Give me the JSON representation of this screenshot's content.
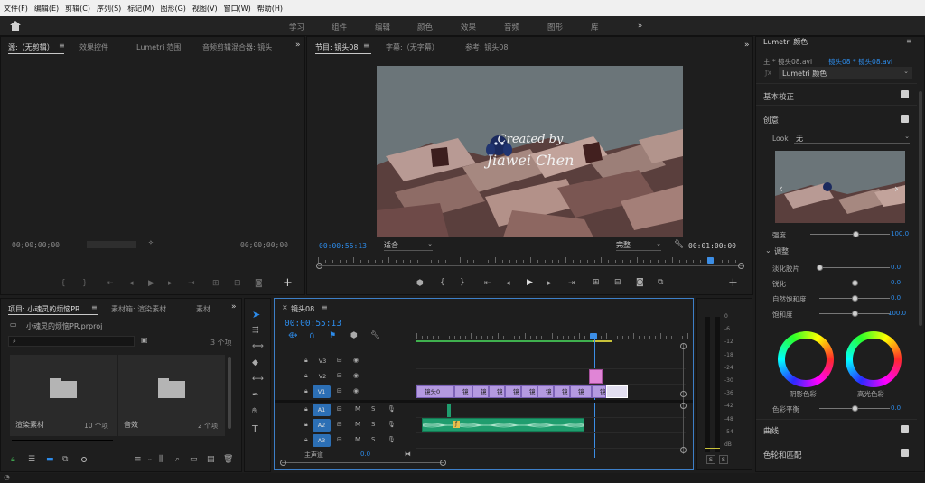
{
  "menu": [
    "文件(F)",
    "编辑(E)",
    "剪辑(C)",
    "序列(S)",
    "标记(M)",
    "图形(G)",
    "视图(V)",
    "窗口(W)",
    "帮助(H)"
  ],
  "workspaces": [
    "学习",
    "组件",
    "编辑",
    "颜色",
    "效果",
    "音频",
    "图形",
    "库"
  ],
  "source_panel": {
    "tabs": [
      "源:（无剪辑）",
      "效果控件",
      "Lumetri 范围",
      "音频剪辑混合器: 镜头"
    ],
    "timecode_left": "00;00;00;00",
    "timecode_right": "00;00;00;00"
  },
  "program_panel": {
    "tabs": [
      "节目: 镜头08",
      "字幕:（无字幕）",
      "参考: 镜头08"
    ],
    "overlay_line1": "Created by",
    "overlay_line2": "Jiawei Chen",
    "timecode": "00:00:55:13",
    "fit": "适合",
    "quality": "完整",
    "duration": "00:01:00:00"
  },
  "project_panel": {
    "tabs": [
      "项目: 小魂灵的烦恼PR",
      "素材箱: 渲染素材",
      "素材"
    ],
    "file": "小魂灵的烦恼PR.prproj",
    "count": "3 个项",
    "bins": [
      {
        "name": "渲染素材",
        "count": "10 个项"
      },
      {
        "name": "音效",
        "count": "2 个项"
      }
    ]
  },
  "timeline": {
    "tab": "镜头08",
    "timecode": "00:00:55:13",
    "video_tracks": [
      "V3",
      "V2",
      "V1"
    ],
    "audio_tracks": [
      "A1",
      "A2",
      "A3"
    ],
    "master": "主声道",
    "master_value": "0.0",
    "m_label": "M",
    "s_label": "S",
    "clip_labels": [
      "镜头0",
      "镜",
      "镜",
      "镜",
      "镜",
      "镜",
      "镜",
      "镜",
      "镜",
      "镜头"
    ]
  },
  "meter": {
    "scale": [
      "0",
      "-6",
      "-12",
      "-18",
      "-24",
      "-30",
      "-36",
      "-42",
      "-48",
      "-54",
      "dB"
    ],
    "solo": [
      "S",
      "S"
    ]
  },
  "lumetri": {
    "title": "Lumetri 颜色",
    "source": "主 * 镜头08.avi",
    "sequence": "镜头08 * 镜头08.avi",
    "fx": "Lumetri 颜色",
    "basic": "基本校正",
    "creative": "创意",
    "look_label": "Look",
    "look_value": "无",
    "intensity_label": "强度",
    "intensity_value": "100.0",
    "adjust": "调整",
    "rows": [
      {
        "label": "淡化胶片",
        "value": "0.0"
      },
      {
        "label": "锐化",
        "value": "0.0"
      },
      {
        "label": "自然饱和度",
        "value": "0.0"
      },
      {
        "label": "饱和度",
        "value": "100.0"
      }
    ],
    "shadow_tint": "阴影色彩",
    "highlight_tint": "高光色彩",
    "tint_balance": "色彩平衡",
    "tint_balance_value": "0.0",
    "curves": "曲线",
    "color_match": "色轮和匹配"
  },
  "colors": {
    "accent": "#2d8ceb",
    "clip": "#b49ae0",
    "audio": "#1f9d6e",
    "playhead": "#3c8ee6"
  }
}
